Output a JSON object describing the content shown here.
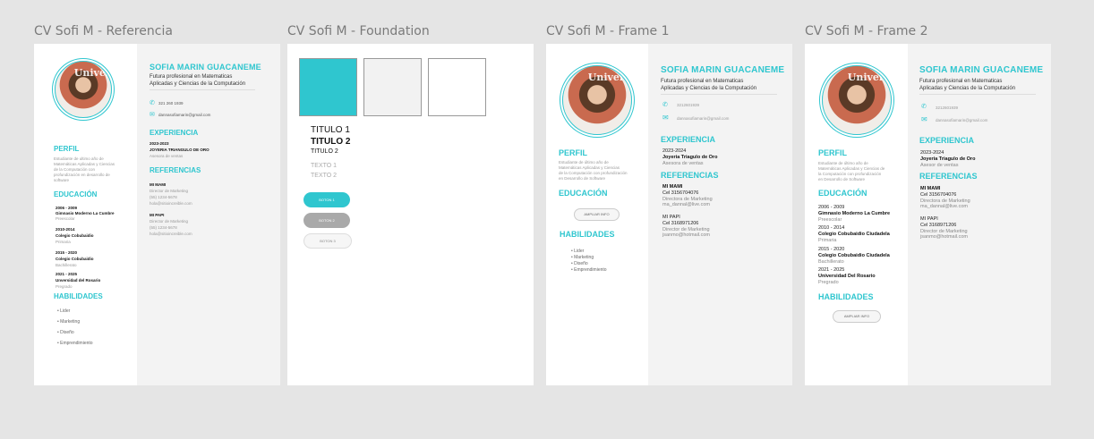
{
  "frames": {
    "ref": "CV Sofi M - Referencia",
    "foundation": "CV Sofi M - Foundation",
    "frame1": "CV Sofi M - Frame 1",
    "frame2": "CV Sofi M - Frame 2"
  },
  "photo_banner": "Universi",
  "ref": {
    "name": "SOFIA MARIN GUACANEME",
    "tagline1": "Futura profesional en Matematicas",
    "tagline2": "Aplicadas y Ciencias de la Computación",
    "phone": "321 260 1939",
    "email": "dannasofiamarin@gmail.com",
    "perfil": "PERFIL",
    "perfil_text": [
      "Estudiante de ultimo año de",
      "Matemáticas Aplicadas y Ciencias",
      "de la Computación con",
      "profundización en desarrollo de",
      "software"
    ],
    "educacion": "EDUCACIÓN",
    "edu": [
      {
        "years": "2006 - 2009",
        "school": "Gimnasio Moderno La Cumbre",
        "level": "Preescolar"
      },
      {
        "years": "2010-2014",
        "school": "Colegio Cobubaidio",
        "level": "Primaria"
      },
      {
        "years": "2015 - 2020",
        "school": "Colegio Cobubaidio",
        "level": "Bachillerato"
      },
      {
        "years": "2021 - 2025",
        "school": "Unversidad del Rosario",
        "level": "Pregrado"
      }
    ],
    "habilidades": "HABILIDADES",
    "skills": [
      "Lider",
      "Marketing",
      "Diseño",
      "Emprendimiento"
    ],
    "experiencia": "EXPERIENCIA",
    "exp_years": "2023-2023",
    "exp_company": "JOYERIA TRIANGULO DE ORO",
    "exp_role": "Asesora de ventas",
    "referencias": "REFERENCIAS",
    "refs": [
      {
        "name": "MI MAMI",
        "role": "Director de Marketing",
        "phone": "(55) 1234-5678",
        "mail": "hola@sitioincreible.com"
      },
      {
        "name": "MI PAPI",
        "role": "Director de Marketing",
        "phone": "(55) 1234-5678",
        "mail": "hola@sitioincreible.com"
      }
    ]
  },
  "foundation": {
    "colors": [
      "#2fc6cf",
      "#f2f2f2",
      "#ffffff"
    ],
    "titulo1a": "TITULO 1",
    "titulo1b": "TITULO 2",
    "titulo2": "TITULO 2",
    "texto1": "TEXTO 1",
    "texto2": "TEXTO 2",
    "boton1": "BOTON 1",
    "boton2": "BOTON 2",
    "boton3": "BOTON 3"
  },
  "f1": {
    "name": "SOFIA MARIN GUACANEME",
    "tagline1": "Futura profesional en Matematicas",
    "tagline2": "Aplicadas y Ciencias de la Computación",
    "phone": "3212601939",
    "email": "dannasofiamarin@gmail.com",
    "perfil": "PERFIL",
    "perfil_text": [
      "Estudiante de último año de",
      "Matemáticas Aplicadas y Ciencias",
      "de la Computación con profundización",
      "en Desarrollo de Software"
    ],
    "educacion": "EDUCACIÓN",
    "ampliar": "AMPLIAR INFO",
    "habilidades": "HABILIDADES",
    "skills": [
      "Lider",
      "Marketing",
      "Diseño",
      "Emprendimiento"
    ],
    "experiencia": "EXPERIENCIA",
    "exp_years": "2023-2024",
    "exp_company": "Joyeria Triagulo de Oro",
    "exp_role": "Asesora de ventas",
    "referencias": "REFERENCIAS",
    "refs": [
      {
        "name": "MI MAMI",
        "phone": "Cel 3156704076",
        "role": "Directora de Marketing",
        "mail": "ma_dannal@live.com"
      },
      {
        "name": "MI PAPI",
        "phone": "Cel 3168971206",
        "role": "Director de Marketing",
        "mail": "jsanmo@hotmail.com"
      }
    ]
  },
  "f2": {
    "name": "SOFIA MARIN GUACANEME",
    "tagline1": "Futura profesional en Matematicas",
    "tagline2": "Aplicadas y Ciencias de la Computación",
    "phone": "3212601939",
    "email": "dannasofiamarin@gmail.com",
    "perfil": "PERFIL",
    "perfil_text": [
      "Estudiante de último año de",
      "Matemáticas Aplicadas y Ciencias de",
      "la Computación con profundización",
      "en Desarrollo de Software"
    ],
    "educacion": "EDUCACIÓN",
    "edu": [
      {
        "years": "2006 - 2009",
        "school": "Gimnasio Moderno La Cumbre",
        "level": "Preescolar"
      },
      {
        "years": "2010 - 2014",
        "school": "Colegio Cobubaidio Ciudadela",
        "level": "Primaria"
      },
      {
        "years": "2015 - 2020",
        "school": "Colegio Cobubaidio Ciudadela",
        "level": "Bachillerato"
      },
      {
        "years": "2021 - 2025",
        "school": "Universidad Del Rosario",
        "level": "Pregrado"
      }
    ],
    "habilidades": "HABILIDADES",
    "ampliar": "AMPLIAR INFO",
    "experiencia": "EXPERIENCIA",
    "exp_years": "2023-2024",
    "exp_company": "Joyeria Triagulo de Oro",
    "exp_role": "Asesor de ventas",
    "referencias": "REFERENCIAS",
    "refs": [
      {
        "name": "MI MAMI",
        "phone": "Cel 3156704076",
        "role": "Directora de Marketing",
        "mail": "ma_dannal@live.com"
      },
      {
        "name": "MI PAPI",
        "phone": "Cel 3168971206",
        "role": "Director de Marketing",
        "mail": "jsanmo@hotmail.com"
      }
    ]
  }
}
